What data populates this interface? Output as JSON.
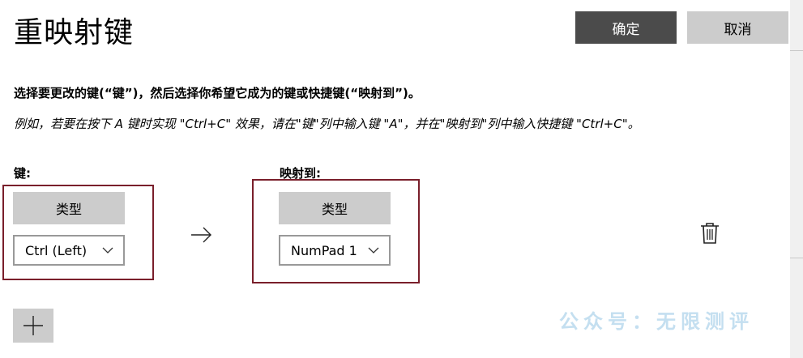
{
  "dialog": {
    "title": "重映射键",
    "ok_label": "确定",
    "cancel_label": "取消",
    "instruction": "选择要更改的键(“键”)，然后选择你希望它成为的键或快捷键(“映射到”)。",
    "example": "例如，若要在按下 A 键时实现 \"Ctrl+C\" 效果，请在\"键\"列中输入键 \"A\"，并在\"映射到\"列中输入快捷键 \"Ctrl+C\"。"
  },
  "columns": {
    "key_label": "键:",
    "map_label": "映射到:"
  },
  "rows": [
    {
      "key_type_label": "类型",
      "key_value": "Ctrl (Left)",
      "map_type_label": "类型",
      "map_value": "NumPad 1"
    }
  ],
  "icons": {
    "arrow": "arrow-right-icon",
    "delete": "trash-icon",
    "dropdown": "chevron-down-icon",
    "add": "plus-icon"
  },
  "watermark": "公众号：无限测评",
  "colors": {
    "primary_button": "#4b4b4b",
    "secondary_button": "#cccccc",
    "highlight_border": "#7a1f2b",
    "watermark": "#c4dff0"
  }
}
